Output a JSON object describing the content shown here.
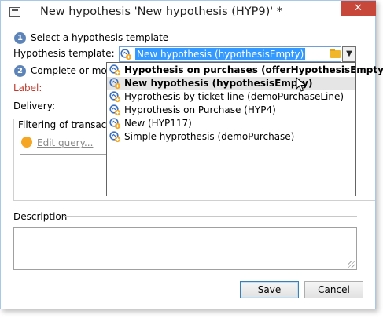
{
  "window": {
    "title": "New hypothesis 'New hypothesis (HYP9)' *",
    "close_glyph": "✕"
  },
  "step1": {
    "number": "1",
    "label": "Select a hypothesis template"
  },
  "template_field": {
    "label": "Hypothesis template:",
    "value": "New hypothesis (hypothesisEmpty)"
  },
  "step2": {
    "number": "2",
    "label": "Complete or modi"
  },
  "label_field": {
    "label": "Label:"
  },
  "delivery_field": {
    "label": "Delivery:"
  },
  "filtering": {
    "label": "Filtering of transactio",
    "edit_query_label": "Edit query..."
  },
  "description": {
    "label": "Description"
  },
  "buttons": {
    "save": "Save",
    "cancel": "Cancel"
  },
  "dropdown": {
    "items": [
      {
        "label": "Hypothesis on purchases (offerHypothesisEmpty)",
        "bold": true
      },
      {
        "label": "New hypothesis (hypothesisEmpty)",
        "bold": true,
        "hover": true
      },
      {
        "label": "Hyprothesis by ticket line (demoPurchaseLine)",
        "bold": false
      },
      {
        "label": "Hyprothesis on Purchase (HYP4)",
        "bold": false
      },
      {
        "label": "New (HYP117)",
        "bold": false
      },
      {
        "label": "Simple hyprothesis  (demoPurchase)",
        "bold": false
      }
    ]
  },
  "icons": {
    "app": "form-icon",
    "hypothesis": "hypothesis-icon",
    "folder": "folder-icon",
    "dropdown": "chevron-down-icon",
    "query": "query-dot-icon"
  },
  "colors": {
    "accent_blue": "#3399ff",
    "step_badge": "#5d84b8",
    "close_red": "#c7473a",
    "label_red": "#c0392b",
    "query_orange": "#f5a623"
  }
}
